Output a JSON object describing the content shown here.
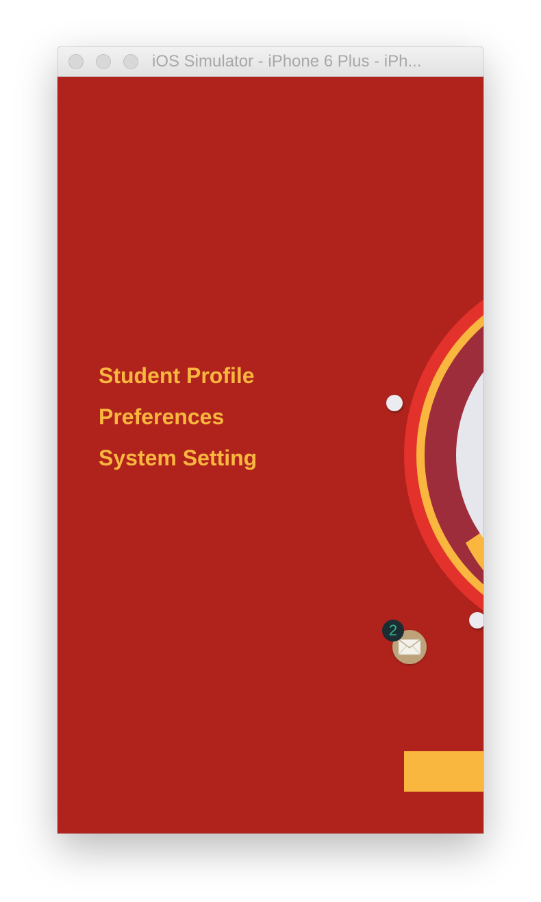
{
  "window": {
    "title": "iOS Simulator - iPhone 6 Plus - iPh..."
  },
  "menu": {
    "items": [
      {
        "label": "Student Profile"
      },
      {
        "label": "Preferences"
      },
      {
        "label": "System Setting"
      }
    ]
  },
  "mail": {
    "badge_count": "2",
    "icon": "envelope-icon"
  },
  "colors": {
    "background": "#b0231c",
    "menu_text": "#f9b73f",
    "outer_ring": "#e3322b",
    "accent_yellow": "#f9b73f",
    "maroon_ring": "#9e2d3c",
    "center_light": "#e6e7ec",
    "badge_bg": "#1b2d33",
    "badge_text": "#35b58e",
    "mail_button": "#bea37a"
  }
}
